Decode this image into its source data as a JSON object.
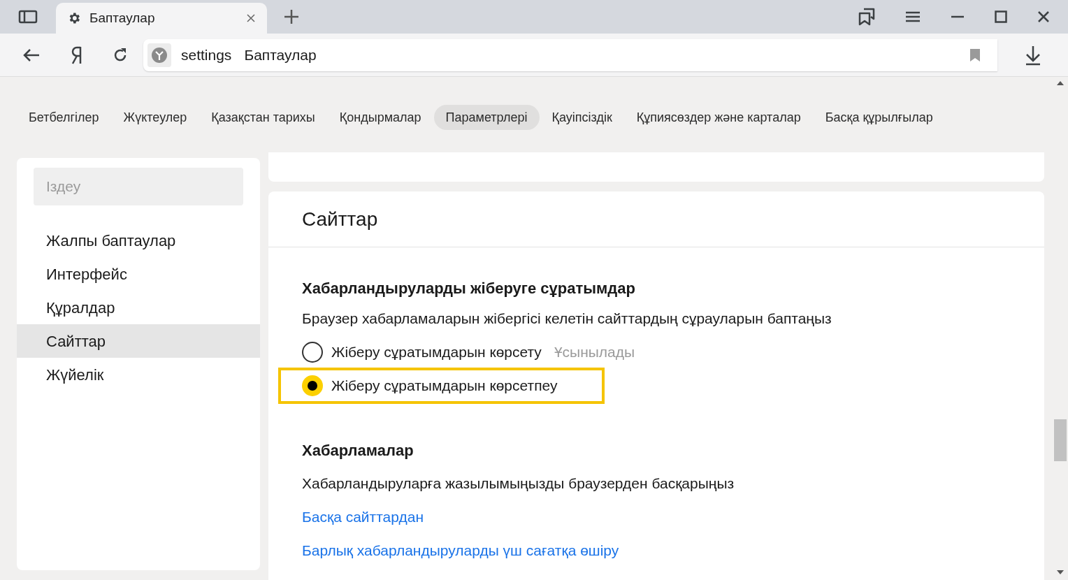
{
  "browser_tab": {
    "title": "Баптаулар"
  },
  "address_bar": {
    "scheme": "settings",
    "title": "Баптаулар"
  },
  "nav_tabs": [
    {
      "label": "Бетбелгілер",
      "selected": false
    },
    {
      "label": "Жүктеулер",
      "selected": false
    },
    {
      "label": "Қазақстан тарихы",
      "selected": false
    },
    {
      "label": "Қондырмалар",
      "selected": false
    },
    {
      "label": "Параметрлері",
      "selected": true
    },
    {
      "label": "Қауіпсіздік",
      "selected": false
    },
    {
      "label": "Құпиясөздер және карталар",
      "selected": false
    },
    {
      "label": "Басқа құрылғылар",
      "selected": false
    }
  ],
  "sidebar": {
    "search": {
      "placeholder": "Іздеу"
    },
    "items": [
      {
        "label": "Жалпы баптаулар",
        "selected": false
      },
      {
        "label": "Интерфейс",
        "selected": false
      },
      {
        "label": "Құралдар",
        "selected": false
      },
      {
        "label": "Сайттар",
        "selected": true
      },
      {
        "label": "Жүйелік",
        "selected": false
      }
    ]
  },
  "section": {
    "title": "Сайттар",
    "requests": {
      "heading": "Хабарландыруларды жіберуге сұратымдар",
      "description": "Браузер хабарламаларын жібергісі келетін сайттардың сұрауларын баптаңыз",
      "options": [
        {
          "label": "Жіберу сұратымдарын көрсету",
          "hint": "Ұсынылады",
          "selected": false,
          "highlighted": false
        },
        {
          "label": "Жіберу сұратымдарын көрсетпеу",
          "selected": true,
          "highlighted": true
        }
      ]
    },
    "notifications": {
      "heading": "Хабарламалар",
      "description": "Хабарландыруларға жазылымыңызды браузерден басқарыңыз",
      "links": [
        "Басқа сайттардан",
        "Барлық хабарландыруларды үш сағатқа өшіру"
      ]
    }
  }
}
